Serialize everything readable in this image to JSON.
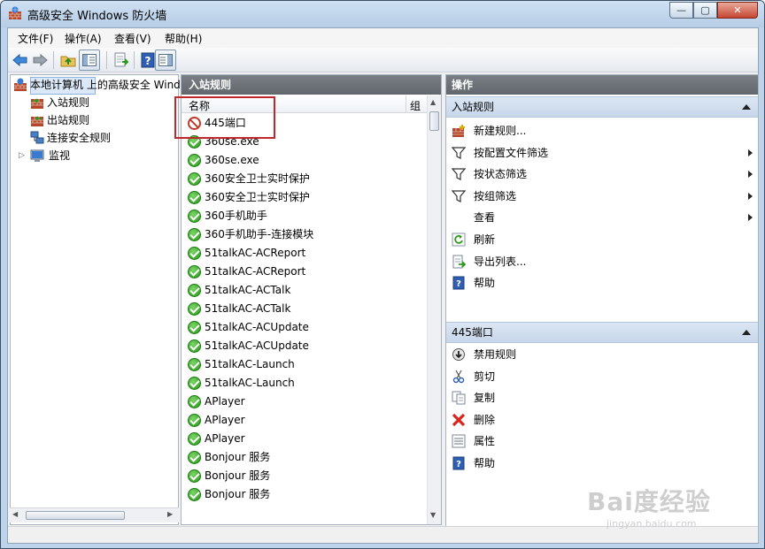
{
  "window": {
    "title": "高级安全 Windows 防火墙",
    "min": "—",
    "max": "▢",
    "close": "✕"
  },
  "menu": [
    "文件(F)",
    "操作(A)",
    "查看(V)",
    "帮助(H)"
  ],
  "tree": {
    "root": "本地计算机 上的高级安全 Wind",
    "items": [
      "入站规则",
      "出站规则",
      "连接安全规则",
      "监视"
    ],
    "expander": "▷"
  },
  "middle": {
    "header": "入站规则",
    "col_name": "名称",
    "col_group": "组",
    "rows": [
      {
        "name": "445端口",
        "status": "blocked"
      },
      {
        "name": "360se.exe",
        "status": "allowed"
      },
      {
        "name": "360se.exe",
        "status": "allowed"
      },
      {
        "name": "360安全卫士实时保护",
        "status": "allowed"
      },
      {
        "name": "360安全卫士实时保护",
        "status": "allowed"
      },
      {
        "name": "360手机助手",
        "status": "allowed"
      },
      {
        "name": "360手机助手-连接模块",
        "status": "allowed"
      },
      {
        "name": "51talkAC-ACReport",
        "status": "allowed"
      },
      {
        "name": "51talkAC-ACReport",
        "status": "allowed"
      },
      {
        "name": "51talkAC-ACTalk",
        "status": "allowed"
      },
      {
        "name": "51talkAC-ACTalk",
        "status": "allowed"
      },
      {
        "name": "51talkAC-ACUpdate",
        "status": "allowed"
      },
      {
        "name": "51talkAC-ACUpdate",
        "status": "allowed"
      },
      {
        "name": "51talkAC-Launch",
        "status": "allowed"
      },
      {
        "name": "51talkAC-Launch",
        "status": "allowed"
      },
      {
        "name": "APlayer",
        "status": "allowed"
      },
      {
        "name": "APlayer",
        "status": "allowed"
      },
      {
        "name": "APlayer",
        "status": "allowed"
      },
      {
        "name": "Bonjour 服务",
        "status": "allowed"
      },
      {
        "name": "Bonjour 服务",
        "status": "allowed"
      },
      {
        "name": "Bonjour 服务",
        "status": "allowed"
      }
    ]
  },
  "actions": {
    "header": "操作",
    "section1": {
      "title": "入站规则",
      "items": [
        {
          "label": "新建规则...",
          "icon": "new-rule-icon",
          "submenu": false
        },
        {
          "label": "按配置文件筛选",
          "icon": "filter-icon",
          "submenu": true
        },
        {
          "label": "按状态筛选",
          "icon": "filter-icon",
          "submenu": true
        },
        {
          "label": "按组筛选",
          "icon": "filter-icon",
          "submenu": true
        },
        {
          "label": "查看",
          "icon": "",
          "submenu": true
        },
        {
          "label": "刷新",
          "icon": "refresh-icon",
          "submenu": false
        },
        {
          "label": "导出列表...",
          "icon": "export-icon",
          "submenu": false
        },
        {
          "label": "帮助",
          "icon": "help-icon",
          "submenu": false
        }
      ]
    },
    "section2": {
      "title": "445端口",
      "items": [
        {
          "label": "禁用规则",
          "icon": "disable-icon"
        },
        {
          "label": "剪切",
          "icon": "cut-icon"
        },
        {
          "label": "复制",
          "icon": "copy-icon"
        },
        {
          "label": "删除",
          "icon": "delete-icon"
        },
        {
          "label": "属性",
          "icon": "properties-icon"
        },
        {
          "label": "帮助",
          "icon": "help-icon"
        }
      ]
    }
  },
  "watermark": {
    "logo": "Bai度经验",
    "url": "jingyan.baidu.com"
  },
  "colors": {
    "accent": "#3399ff",
    "highlight": "#c0272d",
    "panel_header": "#6b7077"
  }
}
